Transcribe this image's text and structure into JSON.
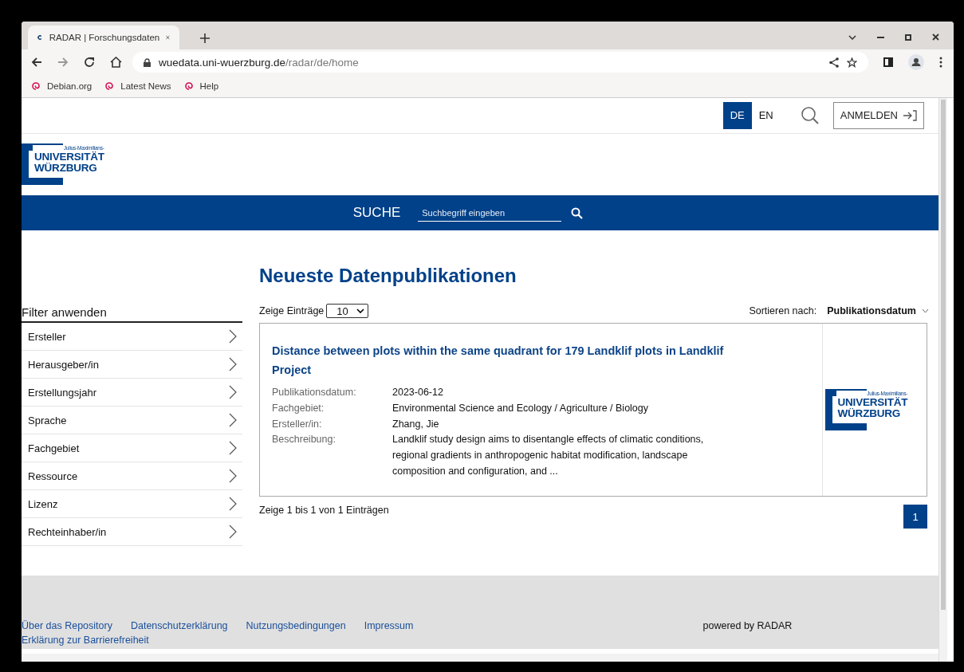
{
  "browser": {
    "tab": {
      "title": "RADAR | Forschungsdaten"
    },
    "url": {
      "host": "wuedata.uni-wuerzburg.de",
      "path": "/radar/de/home"
    },
    "bookmarks": [
      "Debian.org",
      "Latest News",
      "Help"
    ]
  },
  "header": {
    "languages": [
      {
        "label": "DE",
        "selected": true
      },
      {
        "label": "EN",
        "selected": false
      }
    ],
    "login": "ANMELDEN",
    "logo": {
      "top": "Julius-Maximilians-",
      "line1": "UNIVERSITÄT",
      "line2": "WÜRZBURG"
    }
  },
  "search": {
    "label": "SUCHE",
    "placeholder": "Suchbegriff eingeben"
  },
  "heading": "Neueste Datenpublikationen",
  "filters": {
    "title": "Filter anwenden",
    "items": [
      "Ersteller",
      "Herausgeber/in",
      "Erstellungsjahr",
      "Sprache",
      "Fachgebiet",
      "Ressource",
      "Lizenz",
      "Rechteinhaber/in"
    ]
  },
  "list_controls": {
    "entries_label": "Zeige Einträge",
    "entries_value": "10",
    "sort_label": "Sortieren nach:",
    "sort_value": "Publikationsdatum"
  },
  "results": [
    {
      "title": "Distance between plots within the same quadrant for 179 Landklif plots in Landklif Project",
      "fields": [
        {
          "label": "Publikationsdatum:",
          "value": "2023-06-12"
        },
        {
          "label": "Fachgebiet:",
          "value": "Environmental Science and Ecology / Agriculture / Biology"
        },
        {
          "label": "Ersteller/in:",
          "value": "Zhang, Jie"
        },
        {
          "label": "Beschreibung:",
          "value": "Landklif study design aims to disentangle effects of climatic conditions, regional gradients in anthropogenic habitat modification, landscape composition and configuration, and ..."
        }
      ],
      "logo": {
        "top": "Julius-Maximilians-",
        "line1": "UNIVERSITÄT",
        "line2": "WÜRZBURG"
      }
    }
  ],
  "summary": "Zeige 1 bis 1 von 1 Einträgen",
  "pages": [
    {
      "label": "1",
      "selected": true
    }
  ],
  "footer": {
    "links": [
      "Über das Repository",
      "Datenschutzerklärung",
      "Nutzungsbedingungen",
      "Impressum",
      "Erklärung zur Barrierefreiheit"
    ],
    "powered": "powered by RADAR"
  }
}
